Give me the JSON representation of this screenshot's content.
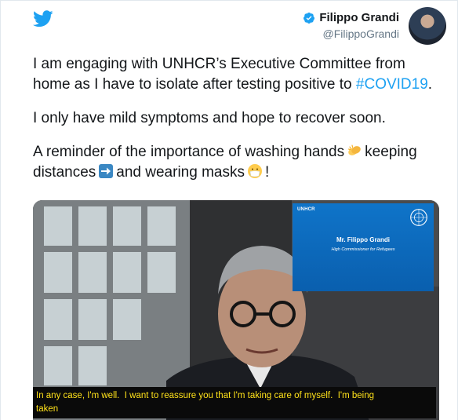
{
  "tweet": {
    "author_name": "Filippo Grandi",
    "author_handle": "@FilippoGrandi",
    "verified": true,
    "paragraphs": {
      "p1_before": "I am engaging with UNHCR’s Executive Committee from home as I have to isolate after testing positive to ",
      "p1_line1": "I am engaging with UNHCR’s Executive Committee from",
      "p1_line2": "home as I have to isolate after testing positive to ",
      "hashtag": "#COVID19",
      "p1_after": ".",
      "p2": "I only have mild symptoms and hope to recover soon.",
      "p3_part1": "A reminder of the importance of washing hands",
      "p3_part2": "keeping",
      "p3_part3": "distances",
      "p3_part4": "and wearing masks",
      "p3_part5": "!"
    },
    "emojis": [
      "clapping-hands-emoji",
      "right-arrow-emoji",
      "face-with-mask-emoji"
    ],
    "colors": {
      "twitter_blue": "#1da1f2",
      "text": "#14171a",
      "handle": "#657786",
      "subtitle_text": "#ffe21a",
      "slide_blue": "#0f74c9"
    }
  },
  "video": {
    "slide": {
      "logo_text": "UNHCR",
      "name": "Mr. Filippo Grandi",
      "title": "High Commissioner for Refugees"
    },
    "subtitle_line1": "In any case, I'm well.  I want to reassure you that I'm taking care of myself.  I'm being",
    "subtitle_line2": "taken"
  }
}
